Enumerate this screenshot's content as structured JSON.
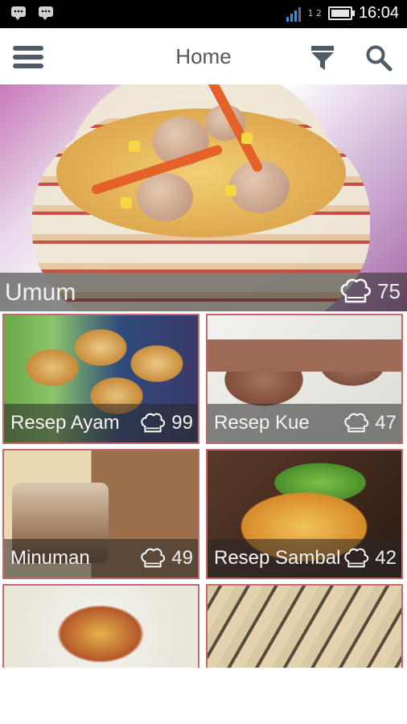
{
  "status_bar": {
    "time": "16:04",
    "sim_label": "1 2"
  },
  "app_bar": {
    "title": "Home"
  },
  "icons": {
    "menu": "hamburger-menu-icon",
    "filter": "filter-icon",
    "search": "search-icon",
    "chef": "chef-hat-icon",
    "message": "message-icon"
  },
  "colors": {
    "tile_border": "#c56a6a",
    "overlay": "rgba(40,40,40,0.55)",
    "icon_gray": "#4f5b66"
  },
  "featured": {
    "name": "Umum",
    "count": "75"
  },
  "categories": [
    {
      "name": "Resep Ayam",
      "count": "99"
    },
    {
      "name": "Resep Kue",
      "count": "47"
    },
    {
      "name": "Minuman",
      "count": "49"
    },
    {
      "name": "Resep Sambal",
      "count": "42"
    },
    {
      "name": "",
      "count": ""
    },
    {
      "name": "",
      "count": ""
    }
  ]
}
